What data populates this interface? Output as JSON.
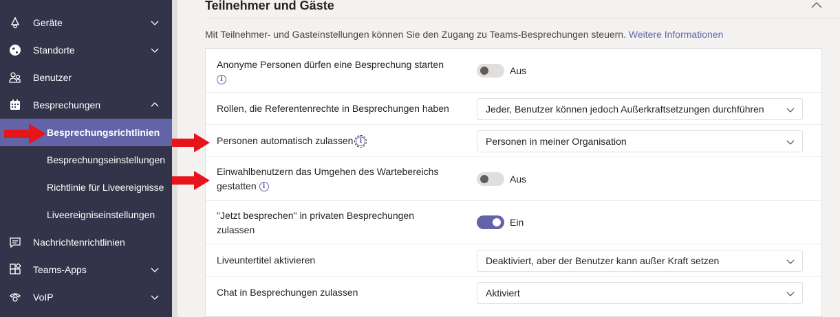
{
  "sidebar": {
    "items": [
      {
        "label": "Geräte",
        "icon": "devices-icon"
      },
      {
        "label": "Standorte",
        "icon": "globe-icon"
      },
      {
        "label": "Benutzer",
        "icon": "users-icon"
      },
      {
        "label": "Besprechungen",
        "icon": "calendar-icon"
      }
    ],
    "subitems": [
      {
        "label": "Besprechungsrichtlinien"
      },
      {
        "label": "Besprechungseinstellungen"
      },
      {
        "label": "Richtlinie für Liveereignisse"
      },
      {
        "label": "Liveereigniseinstellungen"
      }
    ],
    "lower_items": [
      {
        "label": "Nachrichtenrichtlinien",
        "icon": "chat-icon"
      },
      {
        "label": "Teams-Apps",
        "icon": "apps-icon"
      },
      {
        "label": "VoIP",
        "icon": "phone-icon"
      }
    ]
  },
  "section": {
    "title": "Teilnehmer und Gäste",
    "description": "Mit Teilnehmer- und Gasteinstellungen können Sie den Zugang zu Teams-Besprechungen steuern.",
    "link": "Weitere Informationen"
  },
  "settings": [
    {
      "label": "Anonyme Personen dürfen eine Besprechung starten",
      "type": "toggle",
      "state": "off",
      "value": "Aus"
    },
    {
      "label": "Rollen, die Referentenrechte in Besprechungen haben",
      "type": "select",
      "value": "Jeder, Benutzer können jedoch Außerkraftsetzungen durchführen"
    },
    {
      "label": "Personen automatisch zulassen",
      "type": "select",
      "value": "Personen in meiner Organisation"
    },
    {
      "label_line1": "Einwahlbenutzern das Umgehen des Wartebereichs",
      "label_line2": "gestatten",
      "type": "toggle",
      "state": "off",
      "value": "Aus"
    },
    {
      "label_line1": "\"Jetzt besprechen\" in privaten Besprechungen",
      "label_line2": "zulassen",
      "type": "toggle",
      "state": "on",
      "value": "Ein"
    },
    {
      "label": "Liveuntertitel aktivieren",
      "type": "select",
      "value": "Deaktiviert, aber der Benutzer kann außer Kraft setzen"
    },
    {
      "label": "Chat in Besprechungen zulassen",
      "type": "select",
      "value": "Aktiviert"
    }
  ],
  "colors": {
    "accent": "#6264a7",
    "sidebar": "#33344a",
    "arrow": "#e8141b"
  }
}
